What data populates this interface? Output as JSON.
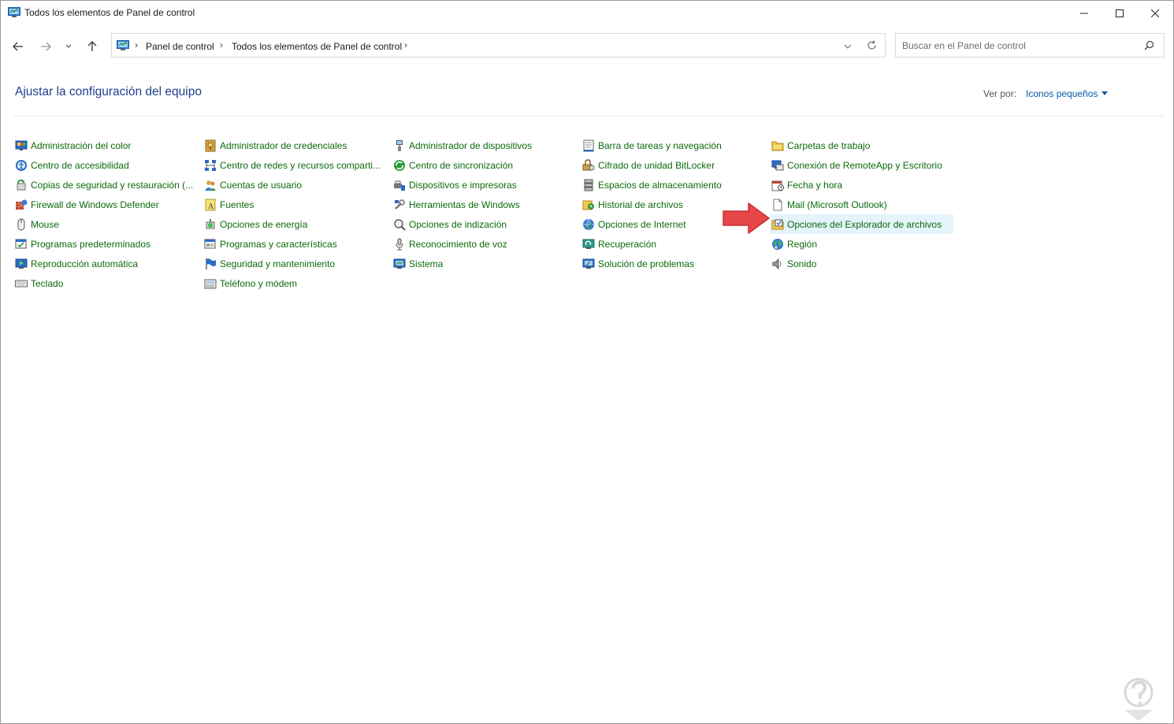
{
  "window": {
    "title": "Todos los elementos de Panel de control"
  },
  "nav": {
    "breadcrumbs": [
      "Panel de control",
      "Todos los elementos de Panel de control"
    ],
    "search_placeholder": "Buscar en el Panel de control"
  },
  "header": {
    "title": "Ajustar la configuración del equipo",
    "view_by_label": "Ver por:",
    "view_by_value": "Iconos pequeños"
  },
  "columns": [
    [
      {
        "label": "Administración del color",
        "icon": "color-management-icon"
      },
      {
        "label": "Centro de accesibilidad",
        "icon": "accessibility-icon"
      },
      {
        "label": "Copias de seguridad y restauración (...",
        "icon": "backup-icon"
      },
      {
        "label": "Firewall de Windows Defender",
        "icon": "firewall-icon"
      },
      {
        "label": "Mouse",
        "icon": "mouse-icon"
      },
      {
        "label": "Programas predeterminados",
        "icon": "default-programs-icon"
      },
      {
        "label": "Reproducción automática",
        "icon": "autoplay-icon"
      },
      {
        "label": "Teclado",
        "icon": "keyboard-icon"
      }
    ],
    [
      {
        "label": "Administrador de credenciales",
        "icon": "credential-manager-icon"
      },
      {
        "label": "Centro de redes y recursos comparti...",
        "icon": "network-center-icon"
      },
      {
        "label": "Cuentas de usuario",
        "icon": "user-accounts-icon"
      },
      {
        "label": "Fuentes",
        "icon": "fonts-icon"
      },
      {
        "label": "Opciones de energía",
        "icon": "power-options-icon"
      },
      {
        "label": "Programas y características",
        "icon": "programs-features-icon"
      },
      {
        "label": "Seguridad y mantenimiento",
        "icon": "security-flag-icon"
      },
      {
        "label": "Teléfono y módem",
        "icon": "phone-modem-icon"
      }
    ],
    [
      {
        "label": "Administrador de dispositivos",
        "icon": "device-manager-icon"
      },
      {
        "label": "Centro de sincronización",
        "icon": "sync-center-icon"
      },
      {
        "label": "Dispositivos e impresoras",
        "icon": "devices-printers-icon"
      },
      {
        "label": "Herramientas de Windows",
        "icon": "windows-tools-icon"
      },
      {
        "label": "Opciones de indización",
        "icon": "indexing-icon"
      },
      {
        "label": "Reconocimiento de voz",
        "icon": "microphone-icon"
      },
      {
        "label": "Sistema",
        "icon": "system-icon"
      }
    ],
    [
      {
        "label": "Barra de tareas y navegación",
        "icon": "taskbar-icon"
      },
      {
        "label": "Cifrado de unidad BitLocker",
        "icon": "bitlocker-icon"
      },
      {
        "label": "Espacios de almacenamiento",
        "icon": "storage-spaces-icon"
      },
      {
        "label": "Historial de archivos",
        "icon": "file-history-icon"
      },
      {
        "label": "Opciones de Internet",
        "icon": "internet-options-icon"
      },
      {
        "label": "Recuperación",
        "icon": "recovery-icon"
      },
      {
        "label": "Solución de problemas",
        "icon": "troubleshooting-icon"
      }
    ],
    [
      {
        "label": "Carpetas de trabajo",
        "icon": "work-folders-icon"
      },
      {
        "label": "Conexión de RemoteApp y Escritorio",
        "icon": "remoteapp-icon"
      },
      {
        "label": "Fecha y hora",
        "icon": "date-time-icon"
      },
      {
        "label": "Mail (Microsoft Outlook)",
        "icon": "mail-icon"
      },
      {
        "label": "Opciones del Explorador de archivos",
        "icon": "explorer-options-icon",
        "highlighted": true
      },
      {
        "label": "Región",
        "icon": "region-icon"
      },
      {
        "label": "Sonido",
        "icon": "sound-icon"
      }
    ]
  ],
  "colors": {
    "title_blue": "#1e3f8f",
    "link_green": "#0b6a0b",
    "link_blue": "#0a5aa6",
    "highlight": "#e5f3fb",
    "arrow_red": "#e8474a"
  }
}
